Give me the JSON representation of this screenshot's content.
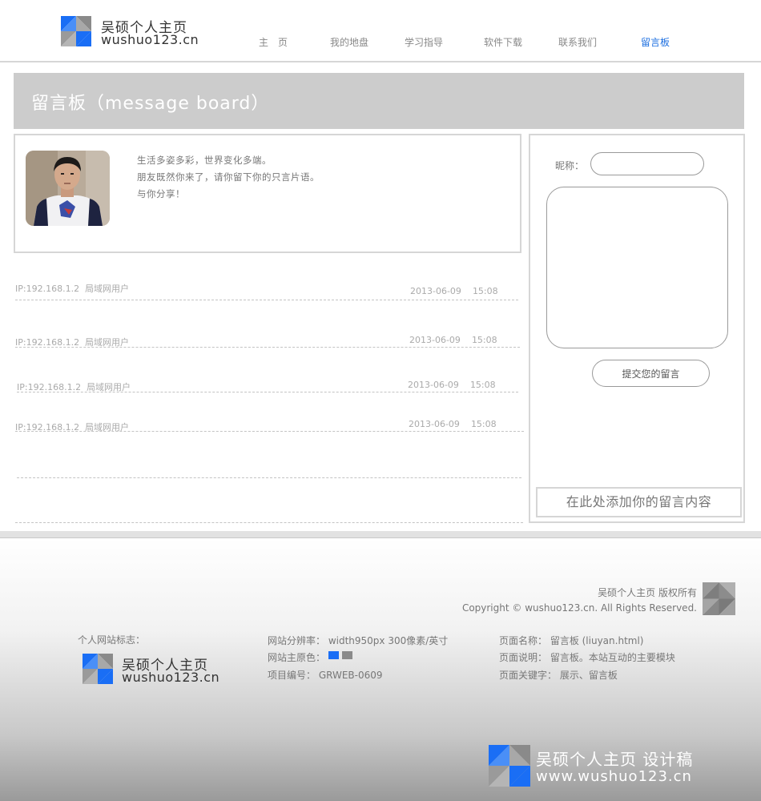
{
  "brand": {
    "name_cn": "吴硕个人主页",
    "domain": "wushuo123.cn",
    "logo_icon": "triangle-tiles-logo",
    "primary_color": "#1a6ef5",
    "secondary_color": "#8a8a8a"
  },
  "nav": {
    "items": [
      {
        "label": "主　页",
        "active": false
      },
      {
        "label": "我的地盘",
        "active": false
      },
      {
        "label": "学习指导",
        "active": false
      },
      {
        "label": "软件下载",
        "active": false
      },
      {
        "label": "联系我们",
        "active": false
      },
      {
        "label": "留言板",
        "active": true
      }
    ],
    "active_color": "#1d6fe0"
  },
  "banner": {
    "title": "留言板（message board）"
  },
  "intro": {
    "lines": [
      "生活多姿多彩，世界变化多端。",
      "朋友既然你来了，请你留下你的只言片语。",
      "与你分享！"
    ]
  },
  "messages": [
    {
      "ip": "IP:192.168.1.2",
      "user": "局域网用户",
      "date": "2013-06-09",
      "time": "15:08"
    },
    {
      "ip": "IP:192.168.1.2",
      "user": "局域网用户",
      "date": "2013-06-09",
      "time": "15:08"
    },
    {
      "ip": "IP:192.168.1.2",
      "user": "局域网用户",
      "date": "2013-06-09",
      "time": "15:08"
    },
    {
      "ip": "IP:192.168.1.2",
      "user": "局域网用户",
      "date": "2013-06-09",
      "time": "15:08"
    }
  ],
  "form": {
    "nickname_label": "昵称：",
    "nickname_value": "",
    "message_value": "",
    "submit_label": "提交您的留言",
    "add_hint": "在此处添加你的留言内容"
  },
  "footer": {
    "copyright_cn": "吴硕个人主页  版权所有",
    "copyright_en": "Copyright © wushuo123.cn. All Rights Reserved.",
    "logo_label": "个人网站标志：",
    "resolution": "网站分辨率：  width950px 300像素/英寸",
    "main_colors_label": "网站主原色：",
    "project_no": "项目编号：  GRWEB-0609",
    "page_name": "页面名称：  留言板   (liuyan.html)",
    "page_desc": "页面说明：  留言板。本站互动的主要模块",
    "page_keywords": "页面关键字：  展示、留言板",
    "watermark_cn": "吴硕个人主页 设计稿",
    "watermark_en": "www.wushuo123.cn"
  }
}
